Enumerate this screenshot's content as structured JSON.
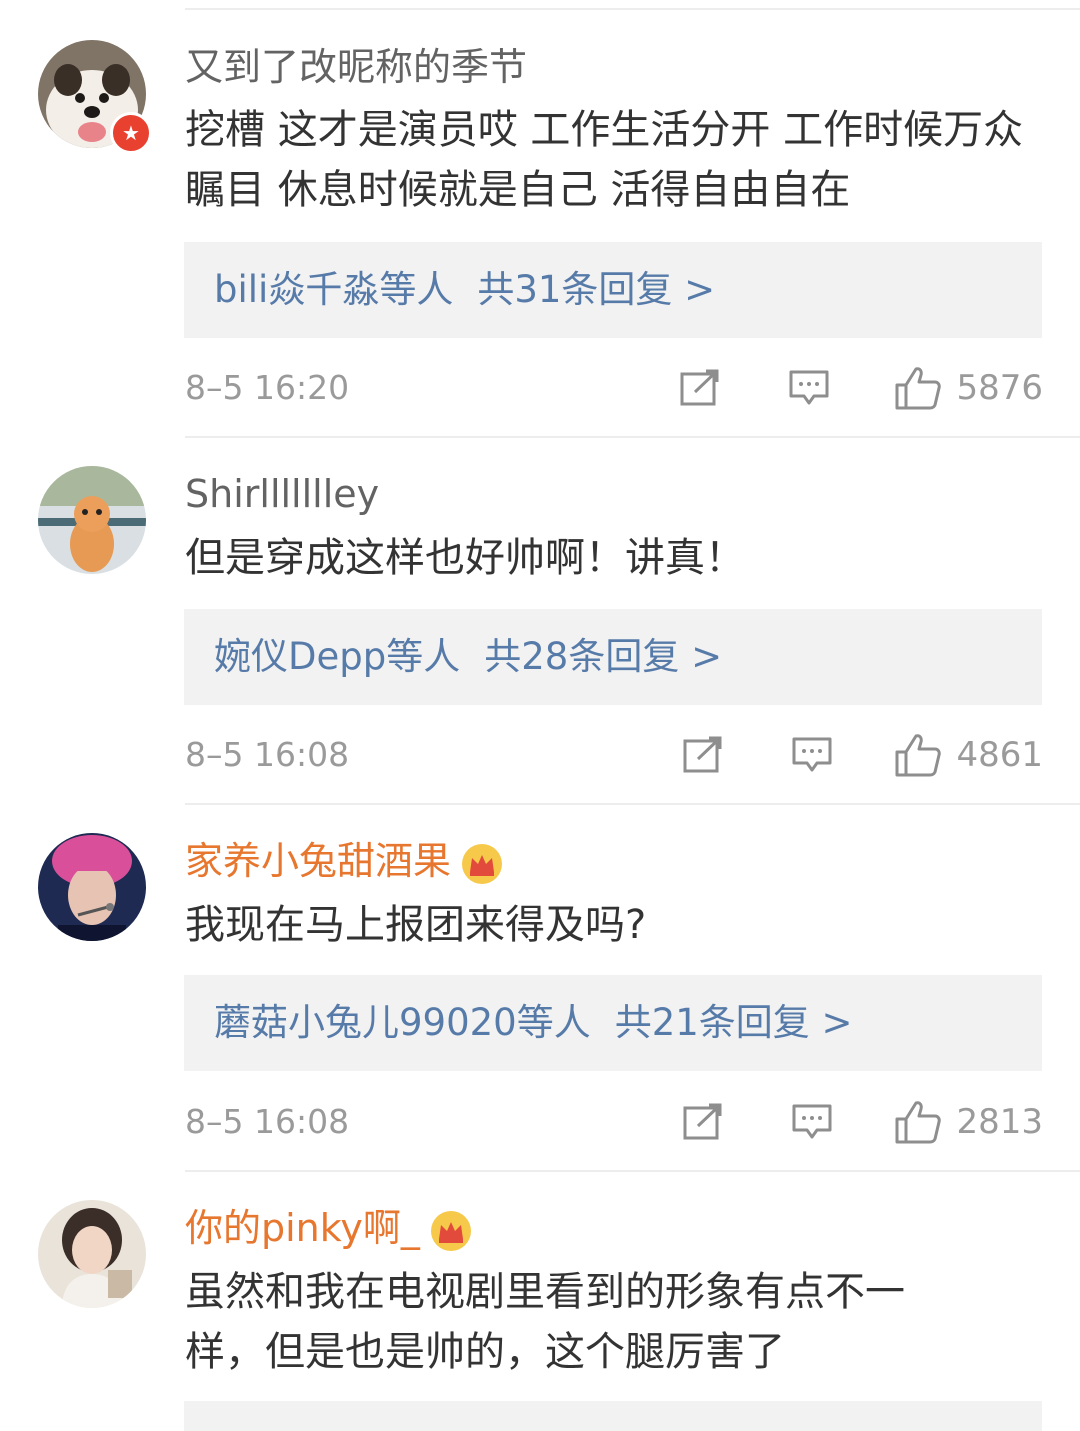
{
  "comments": [
    {
      "username": "又到了改昵称的季节",
      "text": "挖槽 这才是演员哎 工作生活分开 工作时候万众瞩目 休息时候就是自己 活得自由自在",
      "reply_users": "bili焱千淼等人",
      "reply_count": "共31条回复 >",
      "timestamp": "8–5 16:20",
      "likes": "5876"
    },
    {
      "username": "Shirllllllley",
      "text": "但是穿成这样也好帅啊！讲真！",
      "reply_users": "婉仪Depp等人",
      "reply_count": "共28条回复 >",
      "timestamp": "8–5 16:08",
      "likes": "4861"
    },
    {
      "username": "家养小兔甜酒果",
      "text": "我现在马上报团来得及吗?",
      "reply_users": "蘑菇小兔儿99020等人",
      "reply_count": "共21条回复 >",
      "timestamp": "8–5 16:08",
      "likes": "2813"
    },
    {
      "username": "你的pinky啊_",
      "text": "虽然和我在电视剧里看到的形象有点不一样，但是也是帅的，这个腿厉害了"
    }
  ],
  "colors": {
    "username_default": "#636363",
    "username_vip": "#e7762e",
    "reply_link": "#577ba9",
    "meta_gray": "#9a9a9a",
    "reply_bg": "#f2f2f2",
    "badge_red": "#e8412f"
  },
  "icons": {
    "vip_badge": "red-star-badge-icon",
    "member_crown": "crown-icon",
    "repost": "repost-icon",
    "comment": "comment-icon",
    "like": "thumbs-up-icon"
  }
}
